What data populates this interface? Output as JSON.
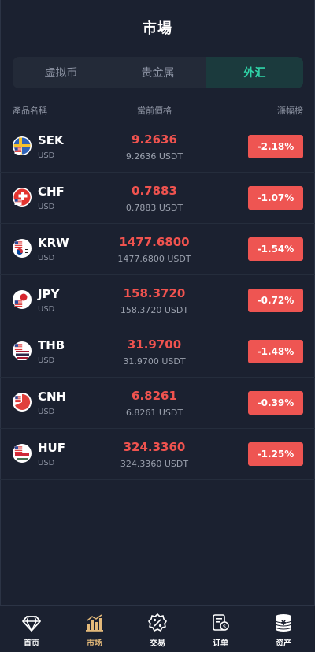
{
  "header": {
    "title": "市場"
  },
  "tabs": [
    {
      "label": "虚拟币",
      "active": false
    },
    {
      "label": "贵金属",
      "active": false
    },
    {
      "label": "外汇",
      "active": true
    }
  ],
  "columns": {
    "name": "產品名稱",
    "price": "當前價格",
    "change": "漲幅榜"
  },
  "rows": [
    {
      "symbol": "SEK",
      "quote": "USD",
      "price": "9.2636",
      "price_usdt": "9.2636 USDT",
      "change": "-2.18%",
      "flag_icon": "sweden-flag-icon"
    },
    {
      "symbol": "CHF",
      "quote": "USD",
      "price": "0.7883",
      "price_usdt": "0.7883 USDT",
      "change": "-1.07%",
      "flag_icon": "switzerland-flag-icon"
    },
    {
      "symbol": "KRW",
      "quote": "USD",
      "price": "1477.6800",
      "price_usdt": "1477.6800 USDT",
      "change": "-1.54%",
      "flag_icon": "south-korea-flag-icon"
    },
    {
      "symbol": "JPY",
      "quote": "USD",
      "price": "158.3720",
      "price_usdt": "158.3720 USDT",
      "change": "-0.72%",
      "flag_icon": "japan-flag-icon"
    },
    {
      "symbol": "THB",
      "quote": "USD",
      "price": "31.9700",
      "price_usdt": "31.9700 USDT",
      "change": "-1.48%",
      "flag_icon": "thailand-flag-icon"
    },
    {
      "symbol": "CNH",
      "quote": "USD",
      "price": "6.8261",
      "price_usdt": "6.8261 USDT",
      "change": "-0.39%",
      "flag_icon": "china-flag-icon"
    },
    {
      "symbol": "HUF",
      "quote": "USD",
      "price": "324.3360",
      "price_usdt": "324.3360 USDT",
      "change": "-1.25%",
      "flag_icon": "hungary-flag-icon"
    }
  ],
  "nav": [
    {
      "label": "首页",
      "icon": "diamond-icon",
      "active": false
    },
    {
      "label": "市场",
      "icon": "bar-chart-icon",
      "active": true
    },
    {
      "label": "交易",
      "icon": "percent-badge-icon",
      "active": false
    },
    {
      "label": "订单",
      "icon": "coin-receipt-icon",
      "active": false
    },
    {
      "label": "资产",
      "icon": "yen-coins-icon",
      "active": false
    }
  ],
  "colors": {
    "background": "#1b2130",
    "accent": "#2fd4a8",
    "down": "#f0534f",
    "nav_active": "#e3b97a"
  }
}
